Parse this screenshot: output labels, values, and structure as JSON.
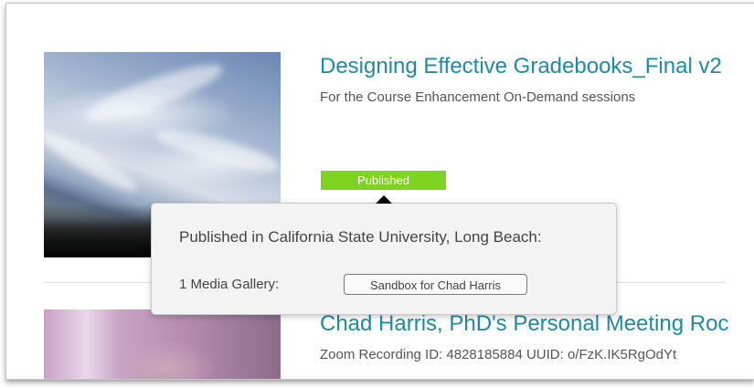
{
  "entries": [
    {
      "title": "Designing Effective Gradebooks_Final v2",
      "description": "For the Course Enhancement On-Demand sessions",
      "status_badge": "Published",
      "status_color": "#7ed321"
    },
    {
      "title": "Chad Harris, PhD's Personal Meeting Roc",
      "description": "Zoom Recording ID: 4828185884 UUID: o/FzK.IK5RgOdYt"
    }
  ],
  "popover": {
    "heading": "Published in California State University, Long Beach:",
    "gallery_label": "1 Media Gallery:",
    "gallery_link": "Sandbox for Chad Harris"
  },
  "colors": {
    "title": "#1f8aa3",
    "badge": "#7ed321"
  }
}
